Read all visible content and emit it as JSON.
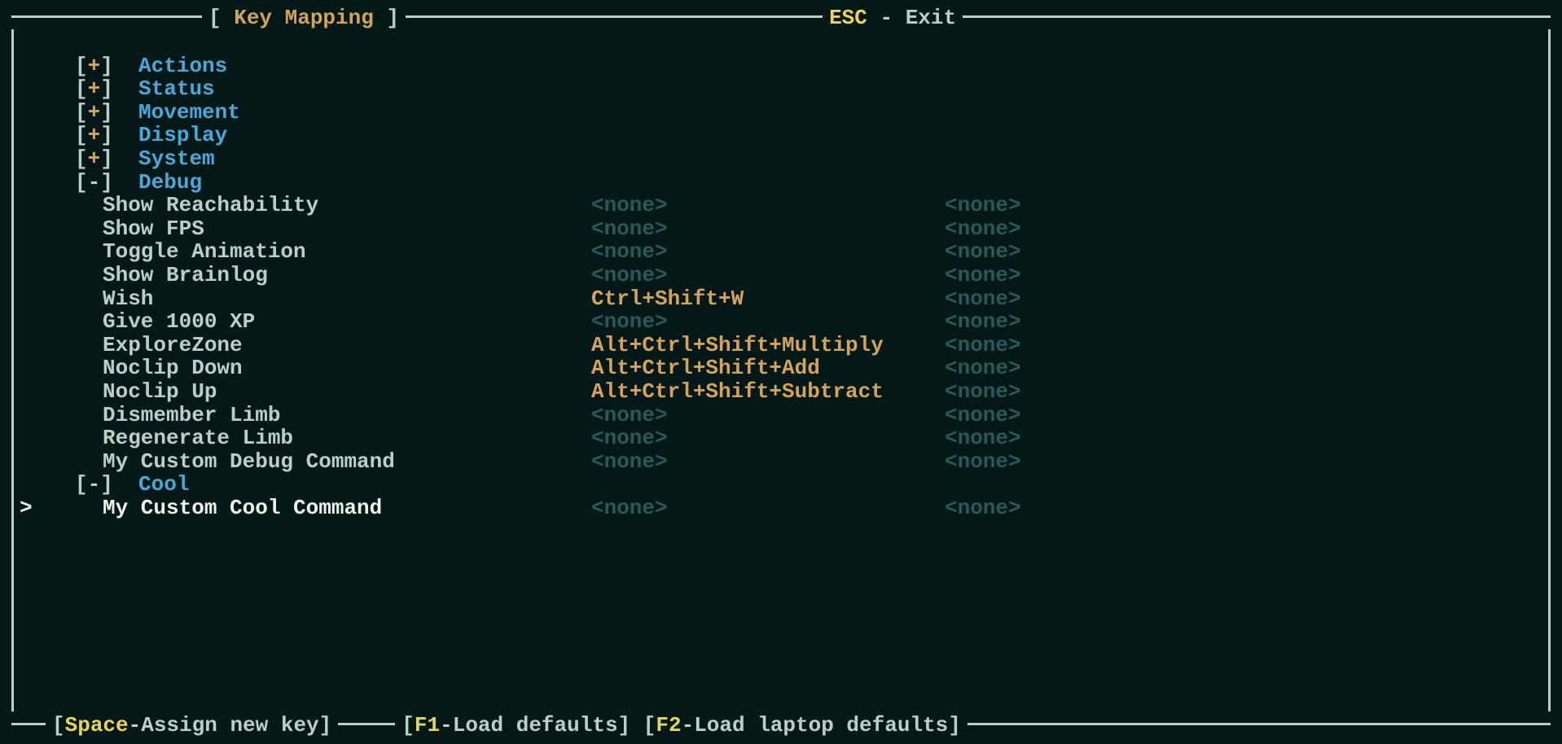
{
  "header": {
    "title": "Key Mapping",
    "esc_key": "ESC",
    "esc_label": "Exit",
    "dash": " - "
  },
  "categories": [
    {
      "name": "Actions",
      "expanded": false,
      "items": []
    },
    {
      "name": "Status",
      "expanded": false,
      "items": []
    },
    {
      "name": "Movement",
      "expanded": false,
      "items": []
    },
    {
      "name": "Display",
      "expanded": false,
      "items": []
    },
    {
      "name": "System",
      "expanded": false,
      "items": []
    },
    {
      "name": "Debug",
      "expanded": true,
      "items": [
        {
          "label": "Show Reachability",
          "bind1": "<none>",
          "bind1_assigned": false,
          "bind2": "<none>",
          "selected": false
        },
        {
          "label": "Show FPS",
          "bind1": "<none>",
          "bind1_assigned": false,
          "bind2": "<none>",
          "selected": false
        },
        {
          "label": "Toggle Animation",
          "bind1": "<none>",
          "bind1_assigned": false,
          "bind2": "<none>",
          "selected": false
        },
        {
          "label": "Show Brainlog",
          "bind1": "<none>",
          "bind1_assigned": false,
          "bind2": "<none>",
          "selected": false
        },
        {
          "label": "Wish",
          "bind1": "Ctrl+Shift+W",
          "bind1_assigned": true,
          "bind2": "<none>",
          "selected": false
        },
        {
          "label": "Give 1000 XP",
          "bind1": "<none>",
          "bind1_assigned": false,
          "bind2": "<none>",
          "selected": false
        },
        {
          "label": "ExploreZone",
          "bind1": "Alt+Ctrl+Shift+Multiply",
          "bind1_assigned": true,
          "bind2": "<none>",
          "selected": false
        },
        {
          "label": "Noclip Down",
          "bind1": "Alt+Ctrl+Shift+Add",
          "bind1_assigned": true,
          "bind2": "<none>",
          "selected": false
        },
        {
          "label": "Noclip Up",
          "bind1": "Alt+Ctrl+Shift+Subtract",
          "bind1_assigned": true,
          "bind2": "<none>",
          "selected": false
        },
        {
          "label": "Dismember Limb",
          "bind1": "<none>",
          "bind1_assigned": false,
          "bind2": "<none>",
          "selected": false
        },
        {
          "label": "Regenerate Limb",
          "bind1": "<none>",
          "bind1_assigned": false,
          "bind2": "<none>",
          "selected": false
        },
        {
          "label": "My Custom Debug Command",
          "bind1": "<none>",
          "bind1_assigned": false,
          "bind2": "<none>",
          "selected": false
        }
      ]
    },
    {
      "name": "Cool",
      "expanded": true,
      "items": [
        {
          "label": "My Custom Cool Command",
          "bind1": "<none>",
          "bind1_assigned": false,
          "bind2": "<none>",
          "selected": true
        }
      ]
    }
  ],
  "footer": {
    "space_key": "Space",
    "space_label": "-Assign new key",
    "f1_key": "F1",
    "f1_label": "-Load defaults",
    "f2_key": "F2",
    "f2_label": "-Load laptop defaults"
  },
  "symbols": {
    "open_bracket": "[",
    "close_bracket": "]",
    "plus": "+",
    "minus": "-",
    "cursor": ">"
  }
}
